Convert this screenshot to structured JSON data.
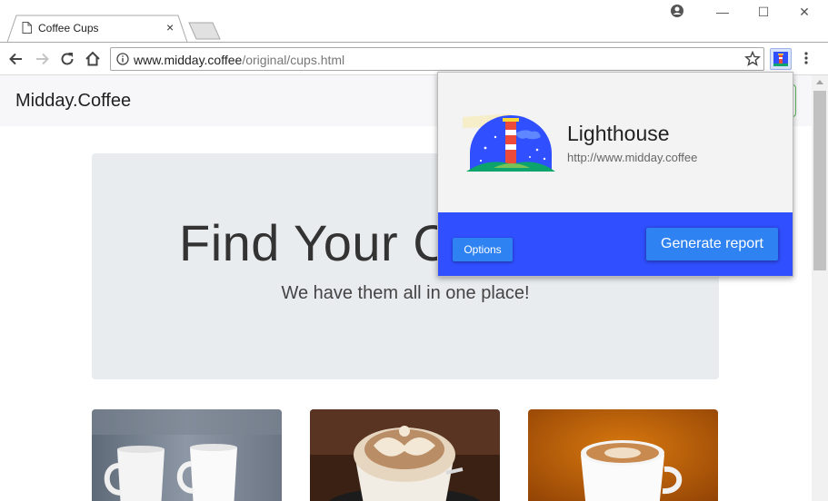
{
  "browser": {
    "tab_title": "Coffee Cups",
    "tab_close": "×",
    "url_host": "www.midday.coffee",
    "url_path": "/original/cups.html",
    "window_controls": {
      "minimize": "—",
      "maximize": "☐",
      "close": "✕"
    }
  },
  "page": {
    "brand": "Midday.Coffee",
    "hero_title": "Find Your Co",
    "hero_subtitle": "We have them all in one place!"
  },
  "lighthouse": {
    "title": "Lighthouse",
    "url": "http://www.midday.coffee",
    "options_label": "Options",
    "generate_label": "Generate report"
  },
  "colors": {
    "popup_footer": "#304ffe",
    "button": "#2f82f1",
    "navbar": "#f7f7f9",
    "jumbotron": "#e9ecef"
  },
  "icons": [
    "page-icon",
    "profile-icon",
    "back-icon",
    "forward-icon",
    "reload-icon",
    "home-icon",
    "info-icon",
    "star-icon",
    "lighthouse-extension-icon",
    "kebab-menu-icon"
  ]
}
